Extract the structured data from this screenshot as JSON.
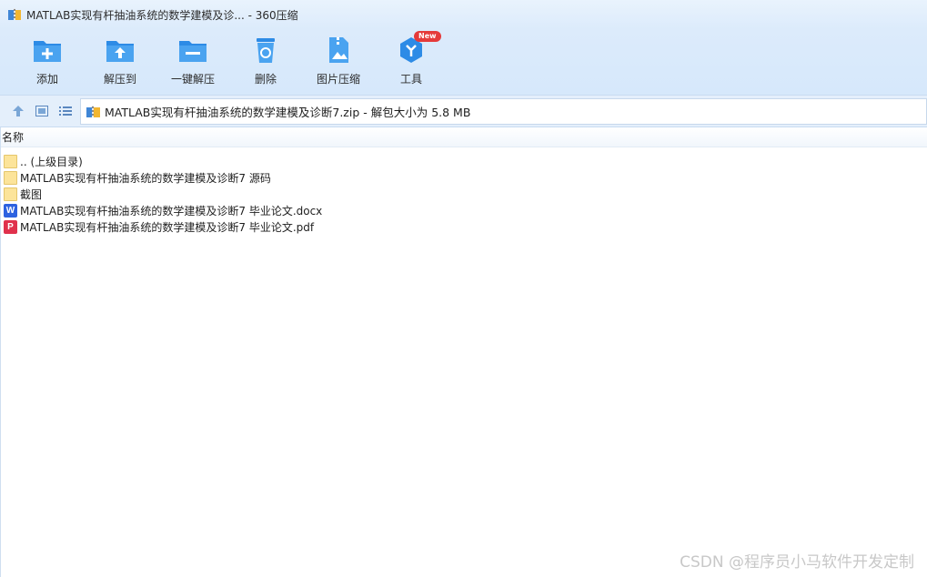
{
  "window": {
    "title": "MATLAB实现有杆抽油系统的数学建模及诊... - 360压缩"
  },
  "toolbar": {
    "items": [
      {
        "label": "添加",
        "icon": "add-folder-icon"
      },
      {
        "label": "解压到",
        "icon": "extract-to-icon"
      },
      {
        "label": "一键解压",
        "icon": "one-click-extract-icon"
      },
      {
        "label": "删除",
        "icon": "recycle-bin-icon"
      },
      {
        "label": "图片压缩",
        "icon": "image-compress-icon"
      },
      {
        "label": "工具",
        "icon": "tools-icon",
        "badge": "New"
      }
    ],
    "accent": "#2d8be6"
  },
  "address": {
    "path": "MATLAB实现有杆抽油系统的数学建模及诊断7.zip - 解包大小为 5.8 MB"
  },
  "list": {
    "column_header": "名称",
    "rows": [
      {
        "name": ".. (上级目录)",
        "type": "folder"
      },
      {
        "name": "MATLAB实现有杆抽油系统的数学建模及诊断7 源码",
        "type": "folder"
      },
      {
        "name": "截图",
        "type": "folder"
      },
      {
        "name": "MATLAB实现有杆抽油系统的数学建模及诊断7 毕业论文.docx",
        "type": "word",
        "glyph": "W"
      },
      {
        "name": "MATLAB实现有杆抽油系统的数学建模及诊断7 毕业论文.pdf",
        "type": "pdf",
        "glyph": "P"
      }
    ]
  },
  "watermark": "CSDN @程序员小马软件开发定制"
}
